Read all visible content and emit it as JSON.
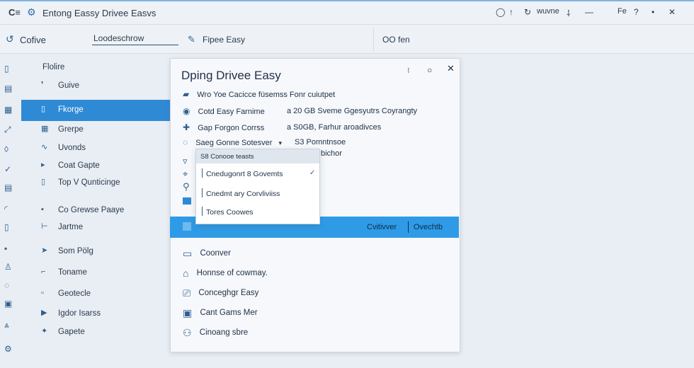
{
  "titlebar": {
    "title": "Entong Eassy Drivee Easvs",
    "right_label": "wuvne",
    "right_label_2": "Fe"
  },
  "toolbar": {
    "label": "Cofive",
    "input_value": "Loodeschrow",
    "action_label": "Fipee Easy",
    "right_label": "OO fen"
  },
  "sidebar": {
    "items": [
      {
        "label": "Flolire",
        "icon": "folder-icon"
      },
      {
        "label": "Guive",
        "icon": "pin-icon"
      },
      {
        "label": "Fkorge",
        "icon": "page-icon",
        "active": true
      },
      {
        "label": "Grerpe",
        "icon": "grid-icon"
      },
      {
        "label": "Uvonds",
        "icon": "wave-icon"
      },
      {
        "label": "Coat Gapte",
        "icon": "flag-icon"
      },
      {
        "label": "Top V Qunticinge",
        "icon": "doc-icon"
      },
      {
        "label": "Co Grewse Paaye",
        "icon": "box-icon"
      },
      {
        "label": "Jartme",
        "icon": "tag-icon"
      },
      {
        "label": "Som Pölg",
        "icon": "arrow-icon"
      },
      {
        "label": "Toname",
        "icon": "clip-icon"
      },
      {
        "label": "Geotecle",
        "icon": "square-icon"
      },
      {
        "label": "Igdor Isarss",
        "icon": "play-icon"
      },
      {
        "label": "Gapete",
        "icon": "star-icon"
      }
    ]
  },
  "dialog": {
    "title": "Dping Drivee Easy",
    "options": [
      {
        "label": "Wro Yoe Cacicce füsemss Fonr cuiutpet",
        "extra": ""
      },
      {
        "label": "Cotd Easy   Farnime",
        "extra": "a 20 GB Sveme Ggesyutrs Coyrangty"
      },
      {
        "label": "Gap Forgon Corrss",
        "extra": "a S0GB, Farhur aroadivces"
      },
      {
        "label": "Saeg Gonne Sotesver",
        "extra": "S3 Pomntnsoe"
      }
    ],
    "dropdown_extra": "bichor"
  },
  "dropdown": {
    "header": "S8 Conooe teasts",
    "items": [
      {
        "label": "Cnedugonrt 8 Govemts",
        "checked": true
      },
      {
        "label": "Cnedmt ary Corvliviiss",
        "checked": false
      },
      {
        "label": "Tores Coowes",
        "checked": false
      }
    ]
  },
  "banner": {
    "link_1": "Cvitivver",
    "link_2": "Ovechtb"
  },
  "bottom": {
    "items": [
      {
        "label": "Coonver",
        "icon": "device-icon"
      },
      {
        "label": "Honnse of cowmay.",
        "icon": "home-icon"
      },
      {
        "label": "Conceghgr Easy",
        "icon": "display-icon"
      },
      {
        "label": "Cant Gams Mer",
        "icon": "camera-icon"
      },
      {
        "label": "Cinoang sbre",
        "icon": "user-icon"
      }
    ]
  },
  "colors": {
    "accent": "#2f8ad6",
    "banner": "#2f9be6",
    "background": "#e9eef4"
  }
}
